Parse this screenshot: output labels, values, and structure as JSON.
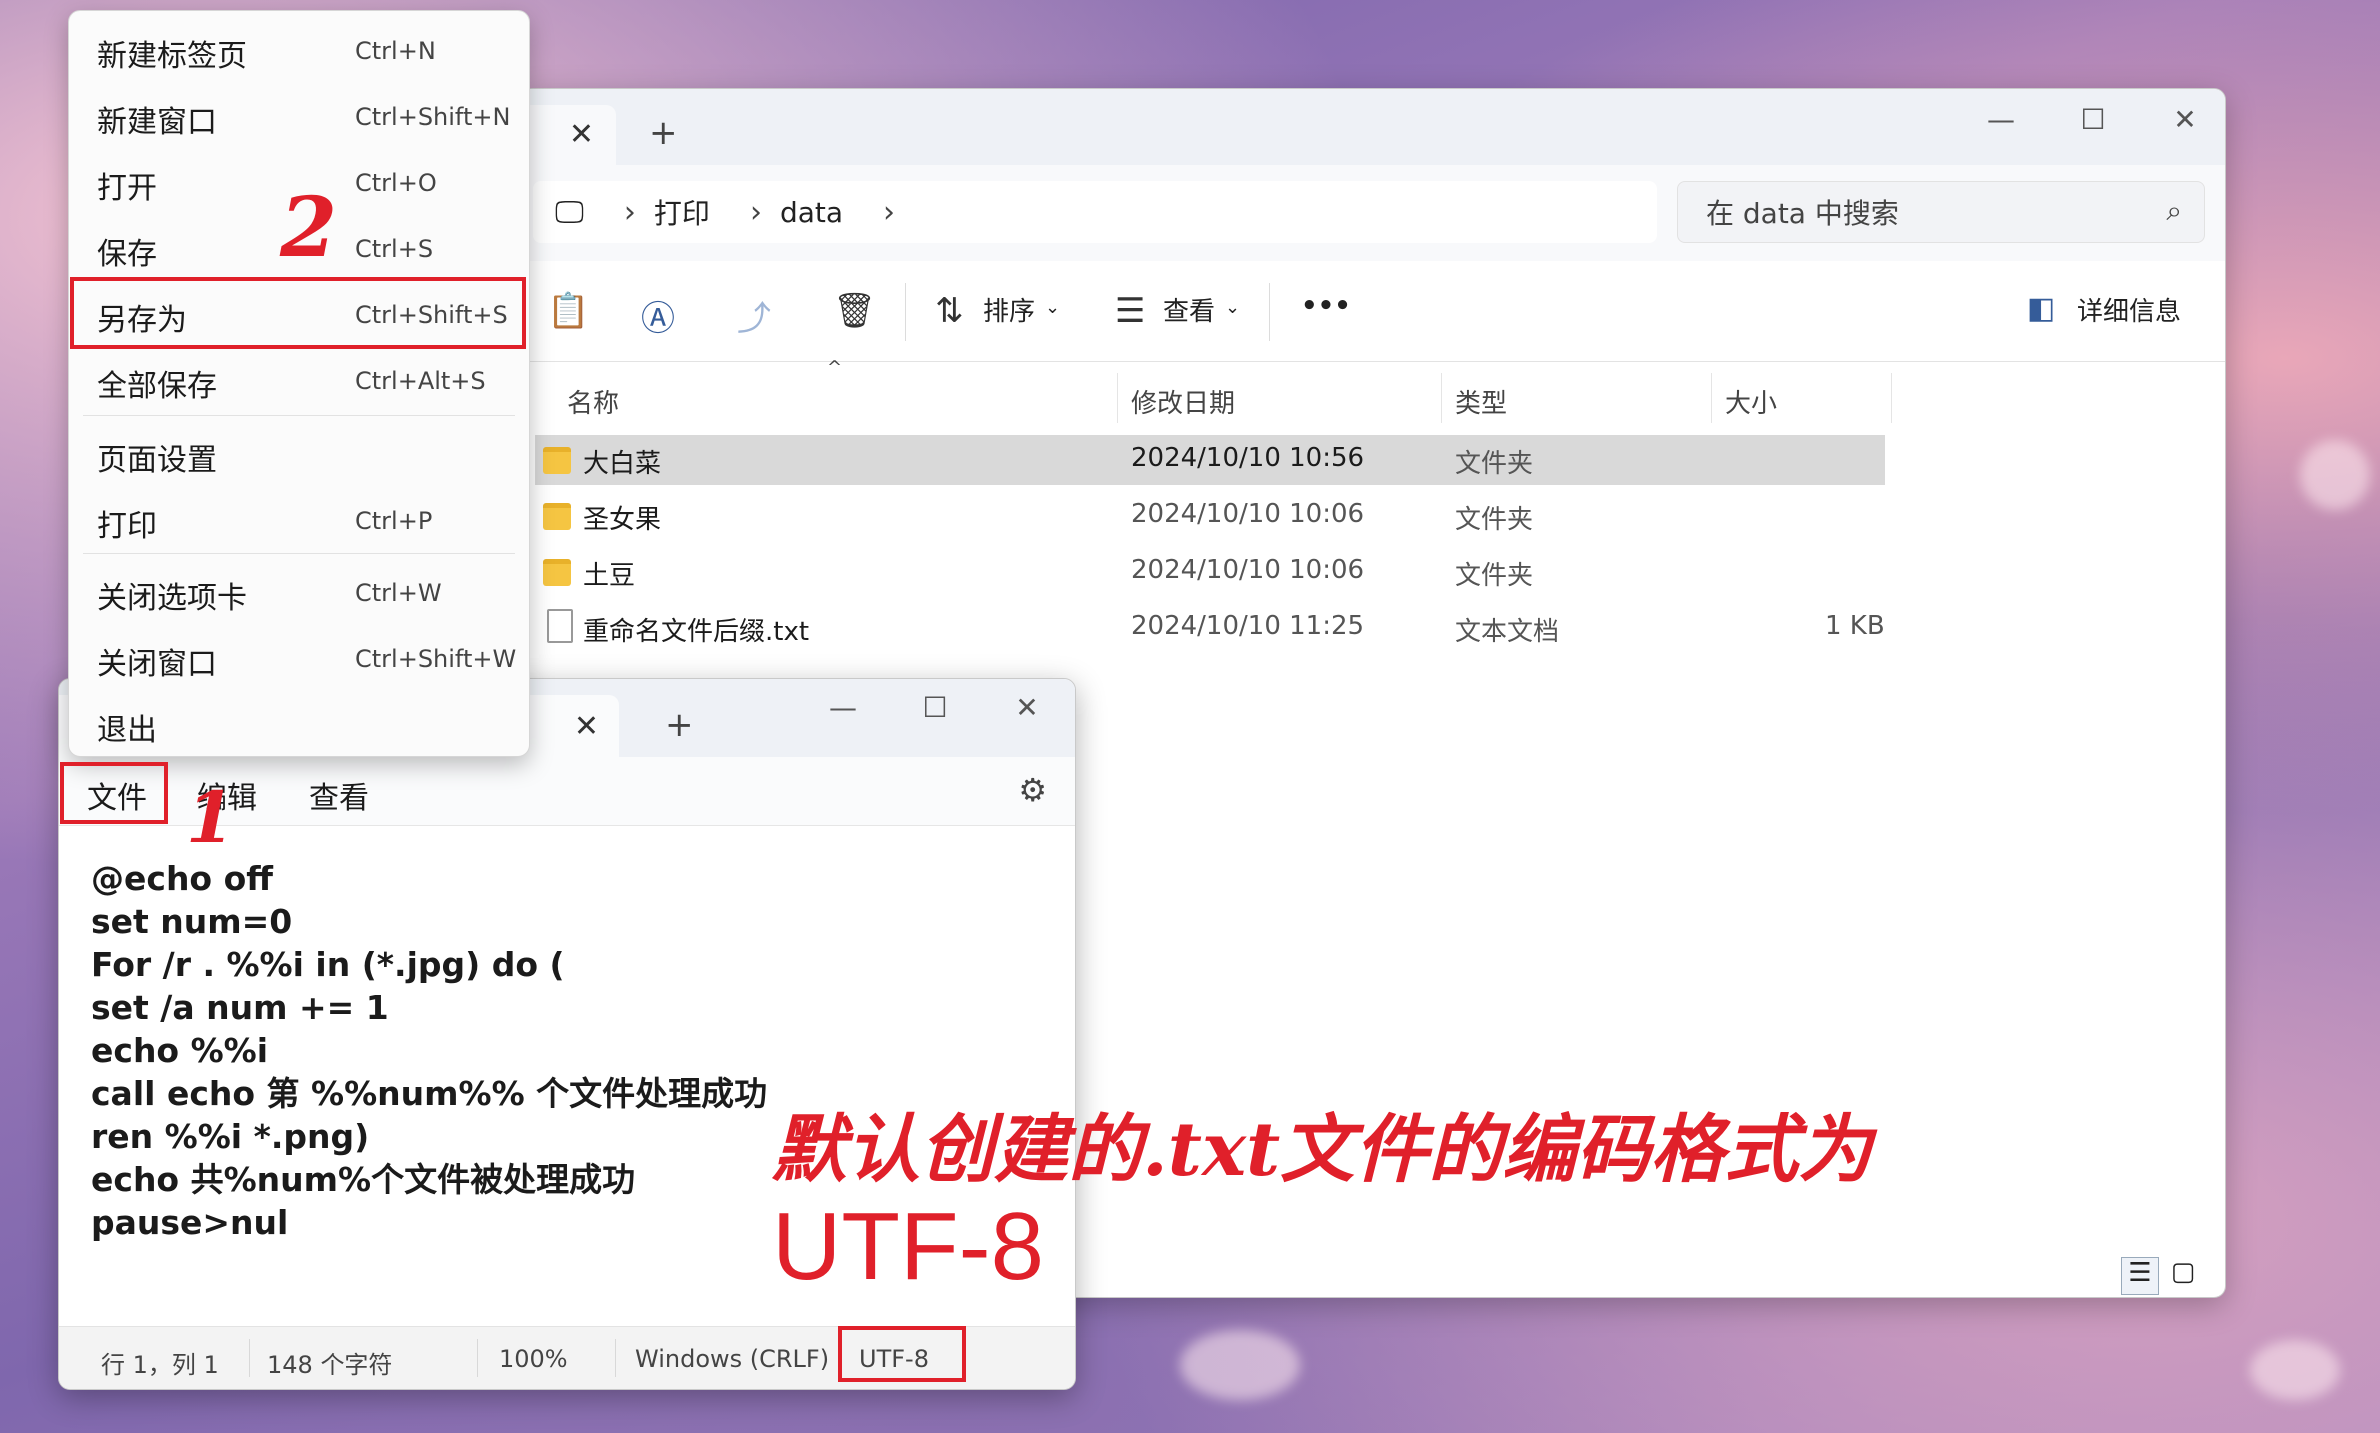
{
  "explorer": {
    "breadcrumb": [
      "打印",
      "data"
    ],
    "search_placeholder": "在 data 中搜索",
    "toolbar": {
      "sort_label": "排序",
      "view_label": "查看",
      "more_label": "•••",
      "details_label": "详细信息"
    },
    "columns": {
      "name": "名称",
      "modified": "修改日期",
      "type": "类型",
      "size": "大小"
    },
    "files": [
      {
        "name": "大白菜",
        "modified": "2024/10/10 10:56",
        "type": "文件夹",
        "size": ""
      },
      {
        "name": "圣女果",
        "modified": "2024/10/10 10:06",
        "type": "文件夹",
        "size": ""
      },
      {
        "name": "土豆",
        "modified": "2024/10/10 10:06",
        "type": "文件夹",
        "size": ""
      },
      {
        "name": "重命名文件后缀.txt",
        "modified": "2024/10/10 11:25",
        "type": "文本文档",
        "size": "1 KB"
      }
    ]
  },
  "notepad": {
    "menu": {
      "file": "文件",
      "edit": "编辑",
      "view": "查看"
    },
    "lines": [
      "@echo off",
      "set num=0",
      "For /r . %%i in (*.jpg) do (",
      "set /a num += 1",
      "echo %%i",
      "call echo 第 %%num%% 个文件处理成功",
      "ren %%i *.png)",
      "echo 共%num%个文件被处理成功",
      "pause>nul"
    ],
    "status": {
      "position": "行 1，列 1",
      "chars": "148 个字符",
      "zoom": "100%",
      "line_ending": "Windows (CRLF)",
      "encoding": "UTF-8"
    }
  },
  "file_menu": [
    {
      "label": "新建标签页",
      "shortcut": "Ctrl+N"
    },
    {
      "label": "新建窗口",
      "shortcut": "Ctrl+Shift+N"
    },
    {
      "label": "打开",
      "shortcut": "Ctrl+O"
    },
    {
      "label": "保存",
      "shortcut": "Ctrl+S"
    },
    {
      "label": "另存为",
      "shortcut": "Ctrl+Shift+S"
    },
    {
      "label": "全部保存",
      "shortcut": "Ctrl+Alt+S"
    },
    {
      "label": "页面设置",
      "shortcut": ""
    },
    {
      "label": "打印",
      "shortcut": "Ctrl+P"
    },
    {
      "label": "关闭选项卡",
      "shortcut": "Ctrl+W"
    },
    {
      "label": "关闭窗口",
      "shortcut": "Ctrl+Shift+W"
    },
    {
      "label": "退出",
      "shortcut": ""
    }
  ],
  "annotations": {
    "step1": "1",
    "step2": "2",
    "note": "默认创建的.txt文件的编码格式为",
    "encoding": "UTF-8"
  },
  "colors": {
    "annotation_red": "#e0202a",
    "selected_row": "#d9d9d9"
  }
}
